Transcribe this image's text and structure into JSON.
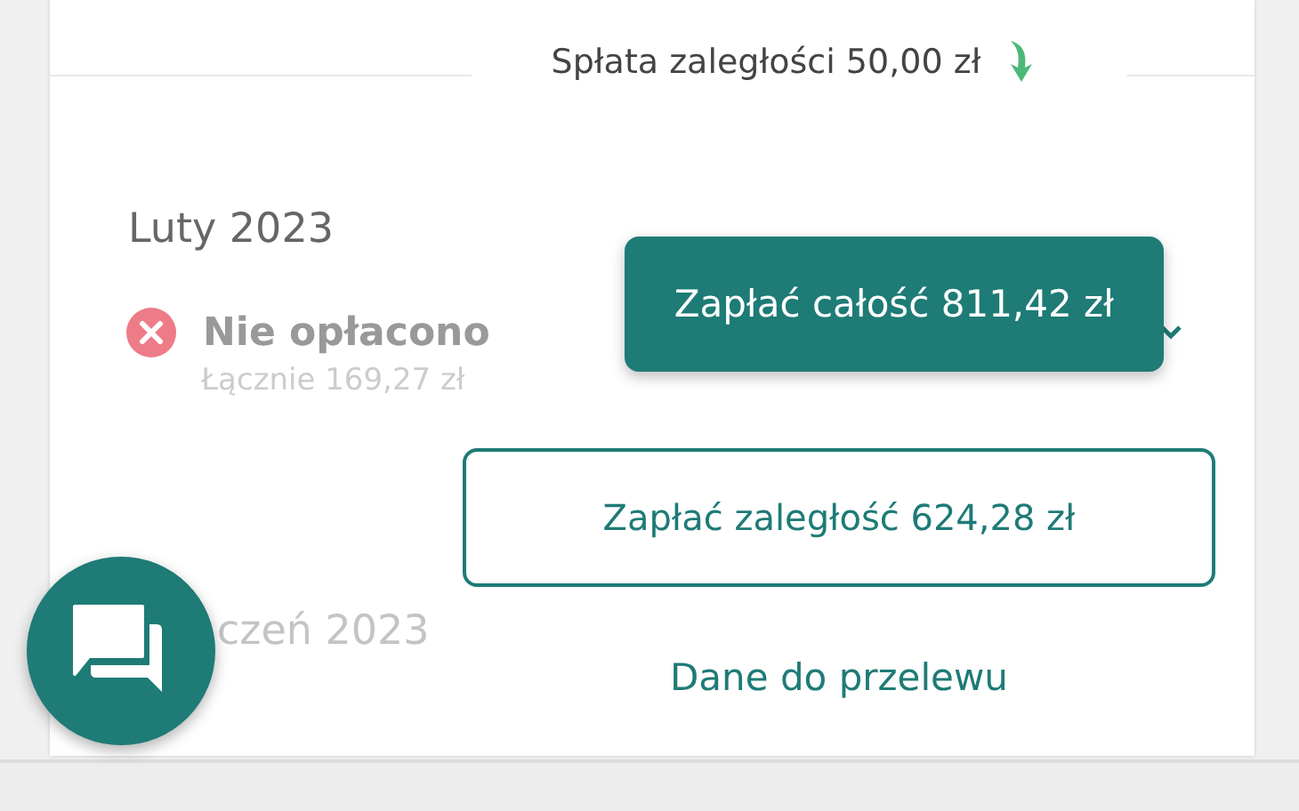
{
  "payment_note": {
    "label": "Spłata zaległości 50,00 zł"
  },
  "months": [
    {
      "title": "Luty 2023",
      "status": "Nie opłacono",
      "paid": false,
      "total": "Łącznie 169,27 zł"
    }
  ],
  "next_month": "czeń 2023",
  "actions": [
    {
      "kind": "primary",
      "label": "Zapłać całość 811,42 zł"
    },
    {
      "kind": "outline",
      "label": "Zapłać zaległość 624,28 zł"
    },
    {
      "kind": "link",
      "label": "Dane do przelewu"
    }
  ]
}
